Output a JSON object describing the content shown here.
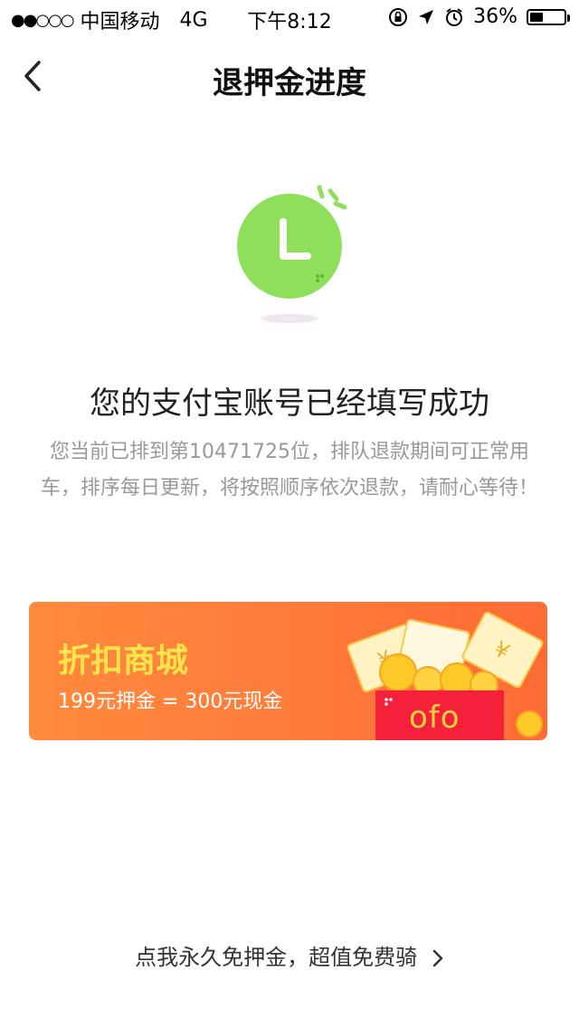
{
  "status_bar": {
    "signal": "●●○○○",
    "carrier": "中国移动",
    "network": "4G",
    "time": "下午8:12",
    "battery": "36%"
  },
  "nav": {
    "title": "退押金进度",
    "back_icon": "chevron-left-icon"
  },
  "illustration": {
    "icon": "clock-icon",
    "clock_color": "#8ee05a"
  },
  "status": {
    "headline": "您的支付宝账号已经填写成功",
    "description": "您当前已排到第10471725位，排队退款期间可正常用车，排序每日更新，将按照顺序依次退款，请耐心等待！"
  },
  "banner": {
    "title": "折扣商城",
    "subtitle": "199元押金 = 300元现金",
    "brand_text": "ofo",
    "title_color": "#ffe54a"
  },
  "footer": {
    "link_text": "点我永久免押金，超值免费骑"
  }
}
